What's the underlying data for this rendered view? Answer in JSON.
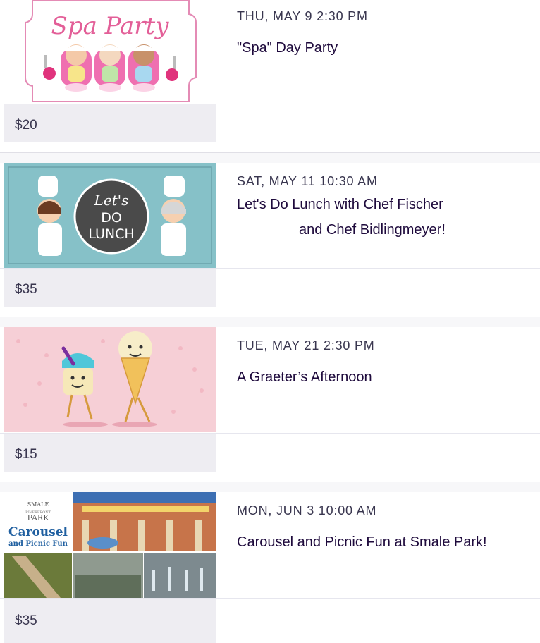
{
  "events": [
    {
      "date": "THU, MAY 9 2:30 PM",
      "title_lines": [
        "\"Spa\" Day Party"
      ],
      "price": "$20",
      "image_text": "Spa Party"
    },
    {
      "date": "SAT, MAY 11 10:30 AM",
      "title_lines": [
        "Let's Do Lunch with Chef Fischer",
        "and Chef Bidlingmeyer!"
      ],
      "price": "$35",
      "image_text": [
        "Let's",
        "DO",
        "LUNCH"
      ]
    },
    {
      "date": "TUE, MAY 21 2:30 PM",
      "title_lines": [
        "A Graeter’s Afternoon"
      ],
      "price": "$15"
    },
    {
      "date": "MON, JUN 3 10:00 AM",
      "title_lines": [
        "Carousel and Picnic Fun at Smale Park!"
      ],
      "price": "$35",
      "image_text": [
        "SMALE",
        "RIVERFRONT",
        "PARK",
        "Carousel",
        "and Picnic Fun"
      ]
    }
  ],
  "colors": {
    "title": "#1e0a3c",
    "date": "#39364f",
    "price_bg": "#eeedf2",
    "lunch_bg": "#86c1c8",
    "icecream_bg": "#f6cfd6"
  }
}
